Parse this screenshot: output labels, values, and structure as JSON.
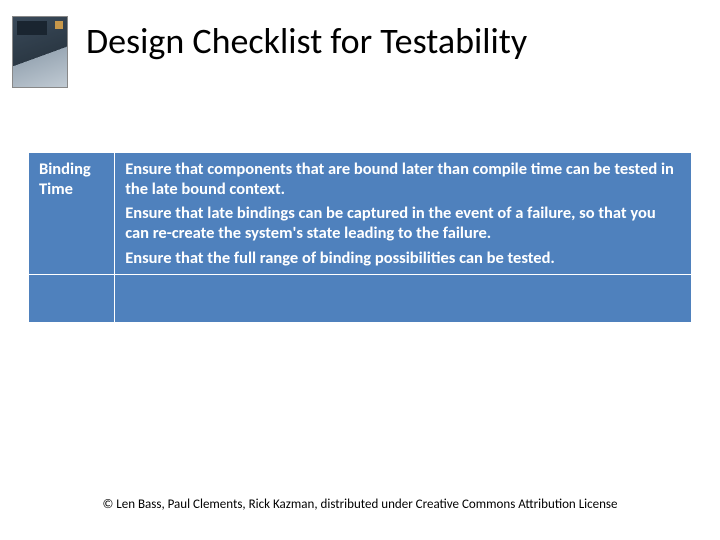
{
  "title": "Design Checklist for Testability",
  "table": {
    "left_label": "Binding Time",
    "paragraphs": [
      "Ensure that components that are bound later than compile time can be tested in the late bound context.",
      "Ensure that late bindings can be captured in the event of a failure, so that you can re-create the system's state leading to the failure.",
      "Ensure that the full range of binding possibilities can be tested."
    ]
  },
  "footer": "© Len Bass, Paul Clements, Rick Kazman, distributed under Creative Commons Attribution License"
}
